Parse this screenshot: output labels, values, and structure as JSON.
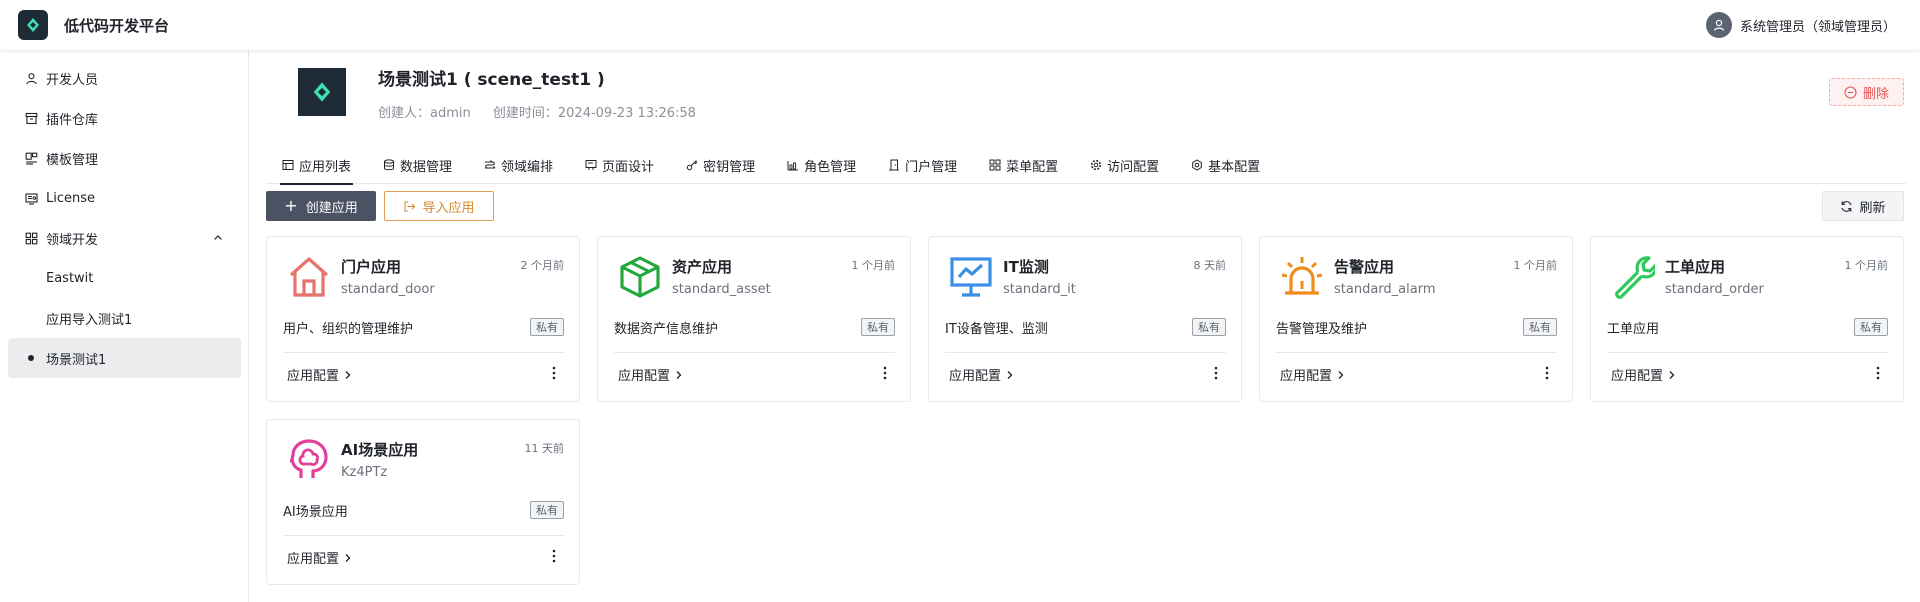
{
  "header": {
    "app_title": "低代码开发平台",
    "user_name": "系统管理员（领域管理员）"
  },
  "sidebar": {
    "items": [
      {
        "label": "开发人员",
        "icon": "user-icon"
      },
      {
        "label": "插件仓库",
        "icon": "archive-icon"
      },
      {
        "label": "模板管理",
        "icon": "template-icon"
      },
      {
        "label": "License",
        "icon": "license-icon"
      },
      {
        "label": "领域开发",
        "icon": "grid-icon",
        "expanded": true
      }
    ],
    "sub_items": [
      {
        "label": "Eastwit"
      },
      {
        "label": "应用导入测试1"
      },
      {
        "label": "场景测试1",
        "active": true
      }
    ]
  },
  "scene": {
    "title": "场景测试1 ( scene_test1 )",
    "creator": "创建人：admin",
    "created_time": "创建时间：2024-09-23 13:26:58",
    "delete_label": "删除"
  },
  "tabs": [
    {
      "label": "应用列表",
      "icon": "app-list-icon",
      "active": true
    },
    {
      "label": "数据管理",
      "icon": "database-icon"
    },
    {
      "label": "领域编排",
      "icon": "orchestration-icon"
    },
    {
      "label": "页面设计",
      "icon": "page-design-icon"
    },
    {
      "label": "密钥管理",
      "icon": "key-icon"
    },
    {
      "label": "角色管理",
      "icon": "role-icon"
    },
    {
      "label": "门户管理",
      "icon": "portal-icon"
    },
    {
      "label": "菜单配置",
      "icon": "menu-icon"
    },
    {
      "label": "访问配置",
      "icon": "gear-icon"
    },
    {
      "label": "基本配置",
      "icon": "settings-icon"
    }
  ],
  "toolbar": {
    "create_label": "创建应用",
    "import_label": "导入应用",
    "refresh_label": "刷新"
  },
  "apps": [
    {
      "name": "门户应用",
      "code": "standard_door",
      "time": "2 个月前",
      "desc": "用户、组织的管理维护",
      "badge": "私有",
      "config": "应用配置",
      "icon": "house-icon",
      "color": "#e8736c"
    },
    {
      "name": "资产应用",
      "code": "standard_asset",
      "time": "1 个月前",
      "desc": "数据资产信息维护",
      "badge": "私有",
      "config": "应用配置",
      "icon": "cube-icon",
      "color": "#22a83c"
    },
    {
      "name": "IT监测",
      "code": "standard_it",
      "time": "8 天前",
      "desc": "IT设备管理、监测",
      "badge": "私有",
      "config": "应用配置",
      "icon": "monitor-icon",
      "color": "#3a8ee6"
    },
    {
      "name": "告警应用",
      "code": "standard_alarm",
      "time": "1 个月前",
      "desc": "告警管理及维护",
      "badge": "私有",
      "config": "应用配置",
      "icon": "alarm-icon",
      "color": "#f08c1c"
    },
    {
      "name": "工单应用",
      "code": "standard_order",
      "time": "1 个月前",
      "desc": "工单应用",
      "badge": "私有",
      "config": "应用配置",
      "icon": "wrench-icon",
      "color": "#2fc85a"
    },
    {
      "name": "AI场景应用",
      "code": "Kz4PTz",
      "time": "11 天前",
      "desc": "AI场景应用",
      "badge": "私有",
      "config": "应用配置",
      "icon": "brain-icon",
      "color": "#e0409a"
    }
  ]
}
